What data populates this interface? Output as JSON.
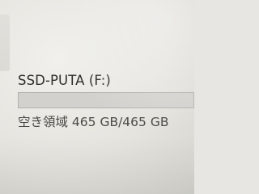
{
  "drive": {
    "name": "SSD-PUTA (F:)",
    "free_space_text": "空き領域 465 GB/465 GB",
    "used_fraction": 0.0,
    "icon": "drive-icon"
  }
}
